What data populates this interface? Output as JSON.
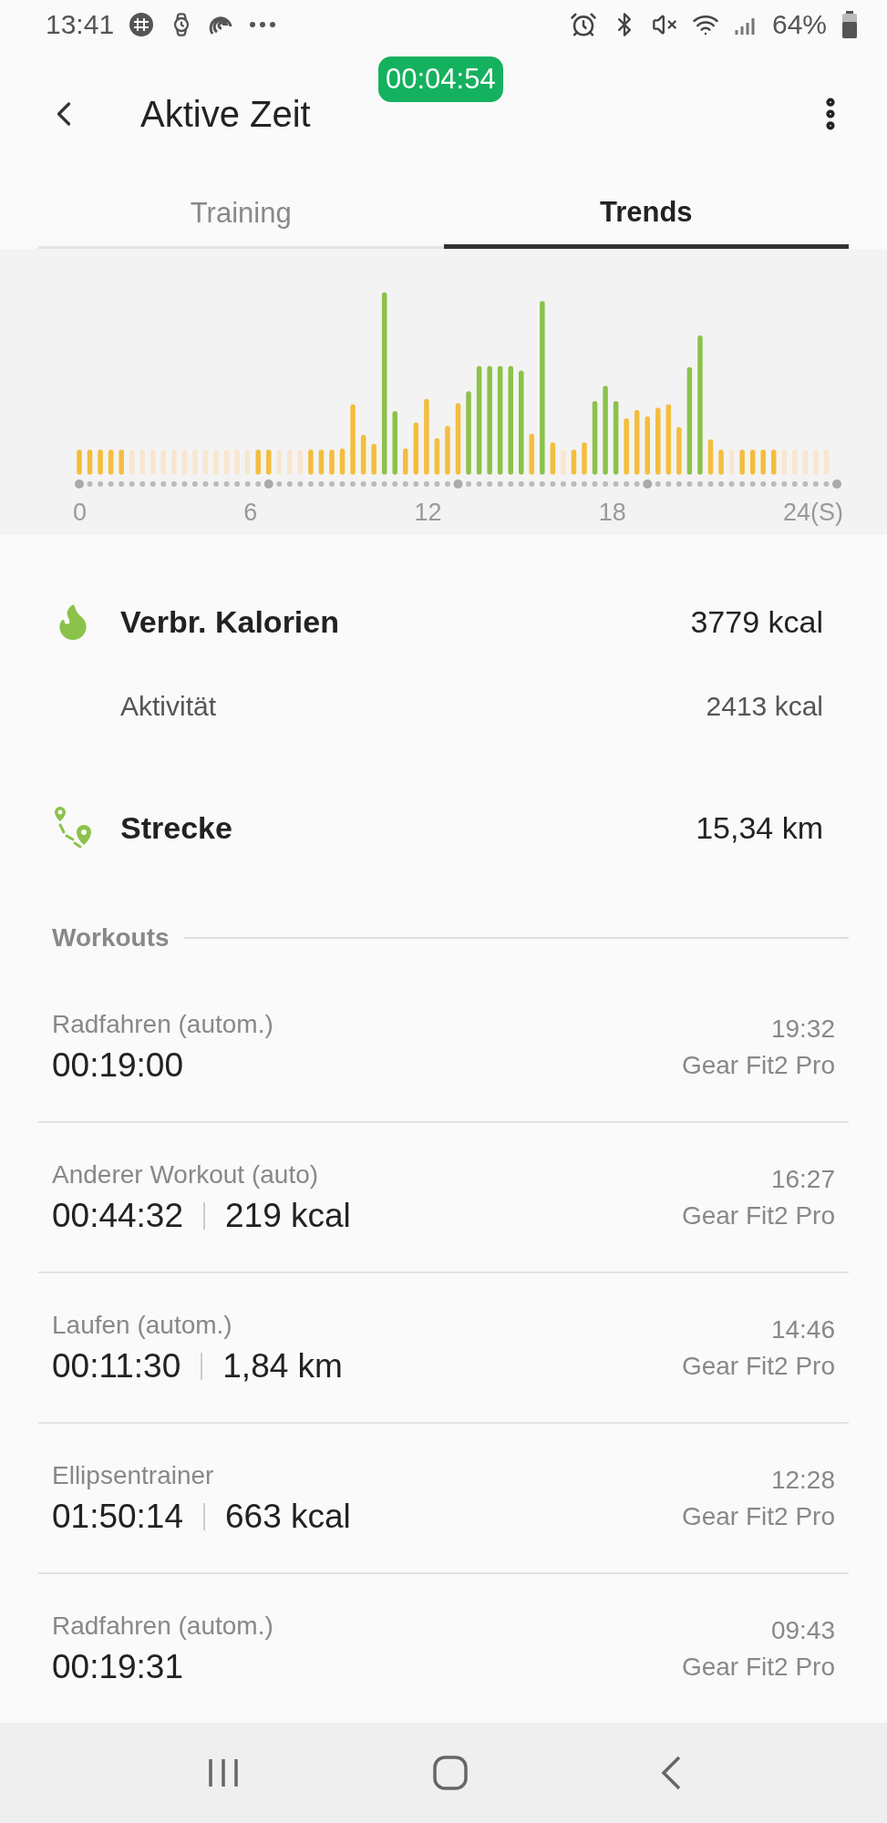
{
  "status_bar": {
    "time": "13:41",
    "battery": "64%"
  },
  "header": {
    "title": "Aktive Zeit",
    "timer": "00:04:54"
  },
  "tabs": [
    {
      "label": "Training",
      "selected": false
    },
    {
      "label": "Trends",
      "selected": true
    }
  ],
  "chart": {
    "axis_labels": [
      "0",
      "6",
      "12",
      "18",
      "24(S)"
    ]
  },
  "stats": [
    {
      "kind": "calories",
      "label": "Verbr. Kalorien",
      "value": "3779 kcal"
    },
    {
      "kind": "sub",
      "label": "Aktivität",
      "value": "2413 kcal"
    },
    {
      "kind": "distance",
      "label": "Strecke",
      "value": "15,34 km"
    }
  ],
  "workouts": {
    "title": "Workouts",
    "items": [
      {
        "name": "Radfahren (autom.)",
        "duration": "00:19:00",
        "clock": "19:32",
        "device": "Gear Fit2 Pro"
      },
      {
        "name": "Anderer Workout (auto)",
        "duration": "00:44:32",
        "extra": "219 kcal",
        "clock": "16:27",
        "device": "Gear Fit2 Pro"
      },
      {
        "name": "Laufen (autom.)",
        "duration": "00:11:30",
        "extra": "1,84 km",
        "clock": "14:46",
        "device": "Gear Fit2 Pro"
      },
      {
        "name": "Ellipsentrainer",
        "duration": "01:50:14",
        "extra": "663 kcal",
        "clock": "12:28",
        "device": "Gear Fit2 Pro"
      },
      {
        "name": "Radfahren (autom.)",
        "duration": "00:19:31",
        "clock": "09:43",
        "device": "Gear Fit2 Pro"
      }
    ]
  }
}
